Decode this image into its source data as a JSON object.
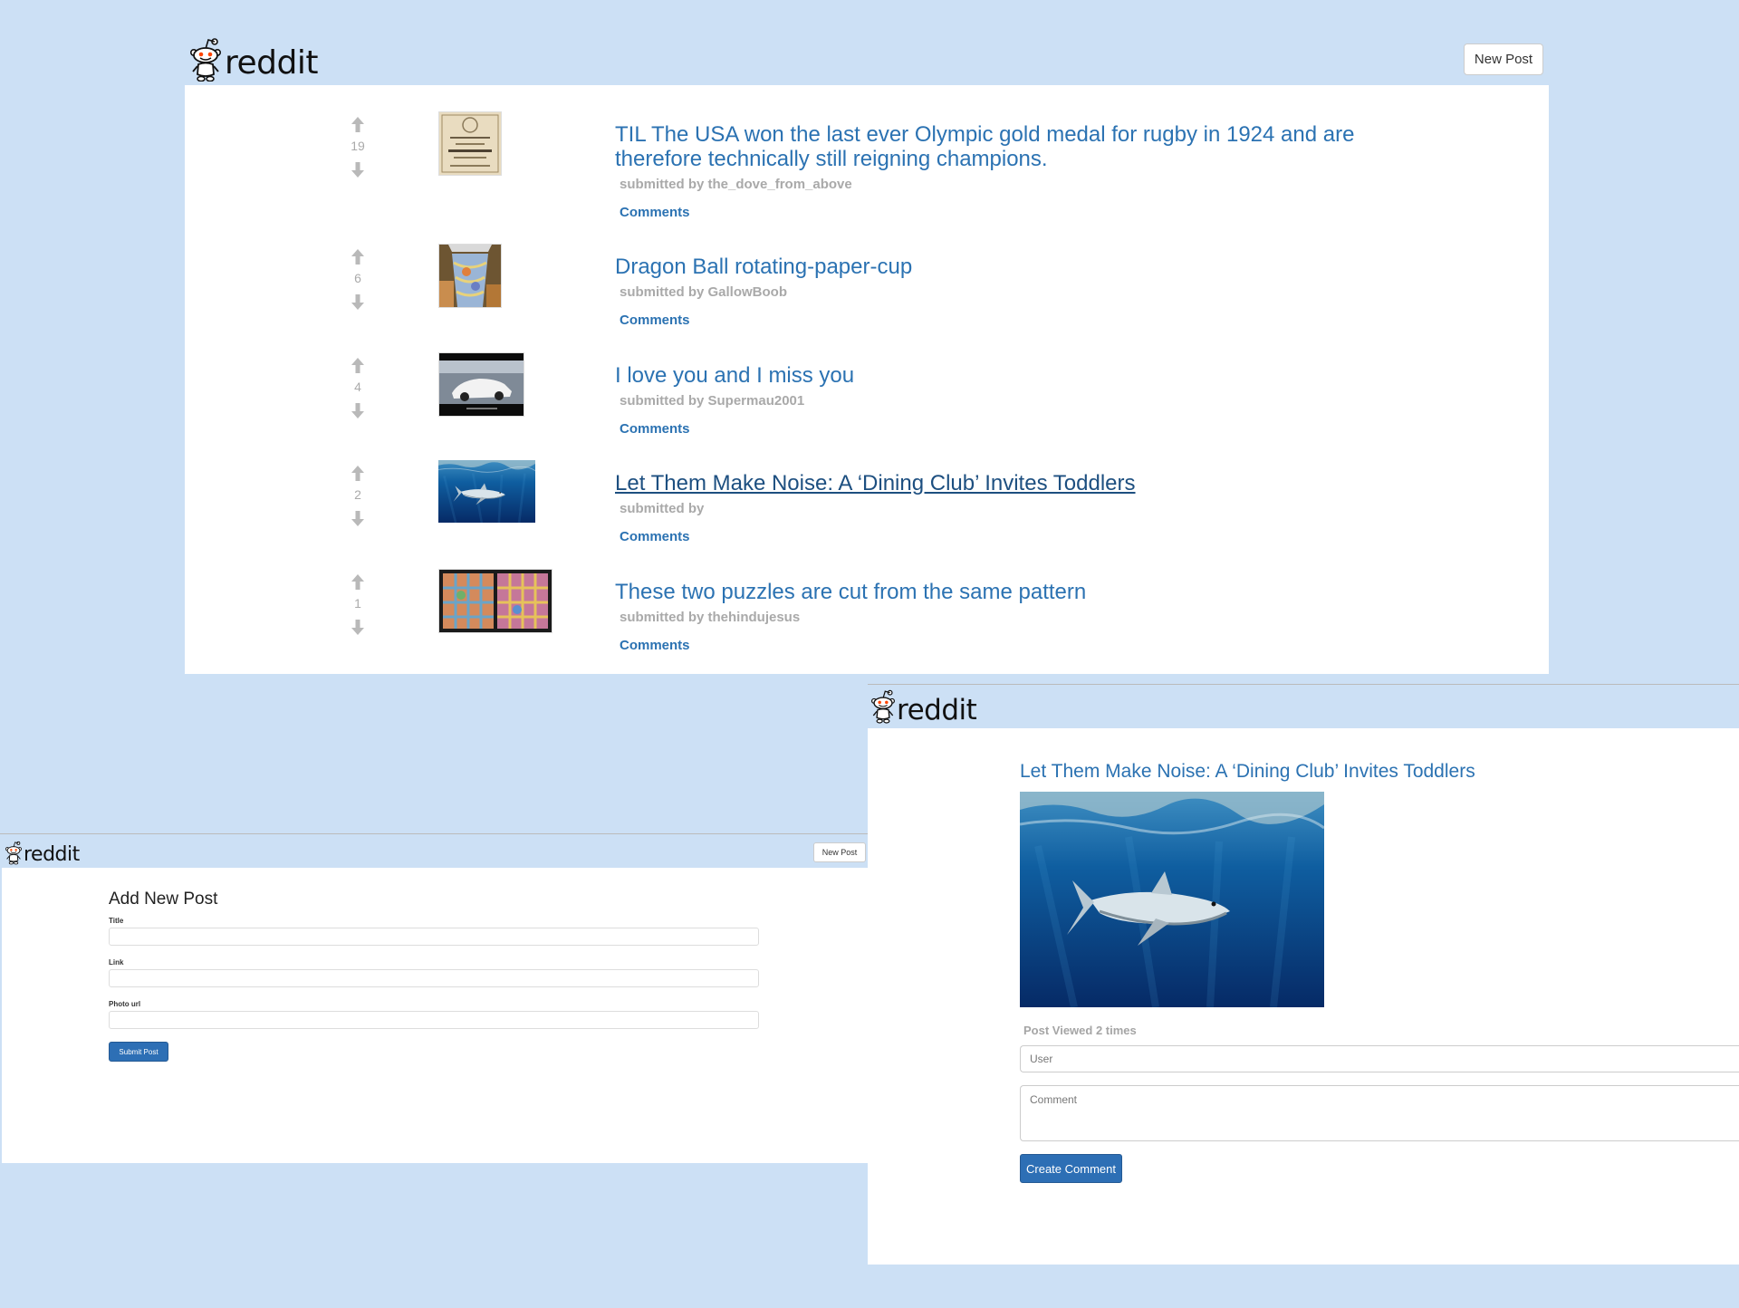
{
  "brand": {
    "logo_text": "reddit"
  },
  "colors": {
    "background": "#cce0f5",
    "link": "#2b72b2",
    "muted": "#a9a9a9",
    "primary_button": "#2d6fb5"
  },
  "listing": {
    "new_post_label": "New Post",
    "posts": [
      {
        "score": "19",
        "title": "TIL The USA won the last ever Olympic gold medal for rugby in 1924 and are therefore technically still reigning champions.",
        "submitted": "submitted by the_dove_from_above",
        "comments_label": "Comments",
        "thumbnail": "rugby-program-image"
      },
      {
        "score": "6",
        "title": "Dragon Ball rotating-paper-cup",
        "submitted": "submitted by GallowBoob",
        "comments_label": "Comments",
        "thumbnail": "paper-cup-image"
      },
      {
        "score": "4",
        "title": "I love you and I miss you",
        "submitted": "submitted by Supermau2001",
        "comments_label": "Comments",
        "thumbnail": "white-car-image"
      },
      {
        "score": "2",
        "title": "Let Them Make Noise: A ‘Dining Club’ Invites Toddlers",
        "submitted": "submitted by",
        "comments_label": "Comments",
        "thumbnail": "shark-image"
      },
      {
        "score": "1",
        "title": "These two puzzles are cut from the same pattern",
        "submitted": "submitted by thehindujesus",
        "comments_label": "Comments",
        "thumbnail": "puzzles-image"
      }
    ]
  },
  "add_post": {
    "new_post_label": "New Post",
    "heading": "Add New Post",
    "title_label": "Title",
    "title_value": "",
    "link_label": "Link",
    "link_value": "",
    "photo_label": "Photo url",
    "photo_value": "",
    "submit_label": "Submit Post"
  },
  "detail": {
    "title": "Let Them Make Noise: A ‘Dining Club’ Invites Toddlers",
    "image": "shark-image",
    "views": "Post Viewed 2 times",
    "user_placeholder": "User",
    "comment_placeholder": "Comment",
    "create_label": "Create Comment"
  }
}
